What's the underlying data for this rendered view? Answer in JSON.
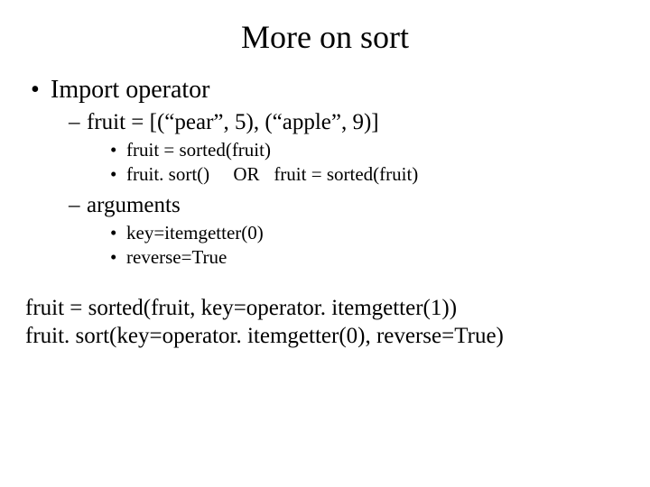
{
  "title": "More on sort",
  "l1": {
    "item0": "Import operator"
  },
  "l2": {
    "item0": "fruit = [(“pear”, 5), (“apple”, 9)]",
    "item1": "arguments"
  },
  "l3a": {
    "item0": "fruit = sorted(fruit)",
    "item1": "fruit. sort()     OR   fruit = sorted(fruit)"
  },
  "l3b": {
    "item0": "key=itemgetter(0)",
    "item1": "reverse=True"
  },
  "bottom": {
    "line0": "fruit = sorted(fruit, key=operator. itemgetter(1))",
    "line1": "fruit. sort(key=operator. itemgetter(0), reverse=True)"
  }
}
